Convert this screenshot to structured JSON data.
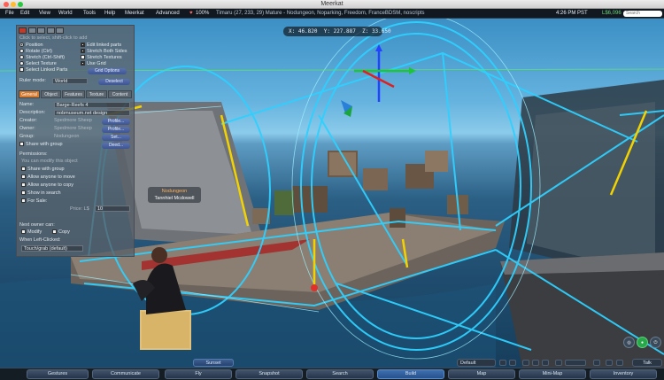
{
  "window": {
    "title": "Meerkat"
  },
  "menu": {
    "items": [
      "File",
      "Edit",
      "View",
      "World",
      "Tools",
      "Help",
      "Meerkat",
      "Advanced"
    ],
    "health": "100%",
    "location": "Timaru (27, 233, 29) Mature - Nodungeon, Noparking, Freedom, FranceBDSM, noscripts",
    "clock": "4:26 PM PST",
    "balance": "L$6,096",
    "search_placeholder": "Search"
  },
  "coords": {
    "x": "X: 46.820",
    "y": "Y: 227.887",
    "z": "Z: 33.650"
  },
  "build_panel": {
    "header": "Click to select, shift-click to add",
    "tool_options": [
      {
        "label": "Position",
        "kind": "radio",
        "checked": true
      },
      {
        "label": "Rotate (Ctrl)",
        "kind": "radio",
        "checked": false
      },
      {
        "label": "Stretch (Ctrl-Shift)",
        "kind": "radio",
        "checked": false
      },
      {
        "label": "Select Texture",
        "kind": "radio",
        "checked": false
      },
      {
        "label": "Select Linked Parts",
        "kind": "check",
        "checked": false
      }
    ],
    "right_options": [
      {
        "label": "Edit linked parts",
        "checked": true
      },
      {
        "label": "Stretch Both Sides",
        "checked": true
      },
      {
        "label": "Stretch Textures",
        "checked": false
      },
      {
        "label": "Use Grid",
        "checked": true
      }
    ],
    "grid_options_btn": "Grid Options",
    "ruler_label": "Ruler mode:",
    "ruler_value": "World",
    "deselect_btn": "Deselect",
    "tabs": [
      "General",
      "Object",
      "Features",
      "Texture",
      "Content"
    ],
    "active_tab": "General",
    "name_label": "Name:",
    "name_value": "Barge-Reefs 4",
    "description_label": "Description:",
    "description_value": "nobmuseum.net design",
    "creator_label": "Creator:",
    "creator_value": "Spedmore Sheep",
    "owner_label": "Owner:",
    "owner_value": "Spedmore Sheep",
    "group_label": "Group:",
    "group_value": "Nodungeon",
    "profile_btn": "Profile...",
    "set_btn": "Set...",
    "share_label": "Share with group",
    "deed_btn": "Deed...",
    "permissions_label": "Permissions:",
    "perm_note": "You can modify this object",
    "perm_options": [
      "Share with group",
      "Allow anyone to move",
      "Allow anyone to copy",
      "Show in search",
      "For Sale:"
    ],
    "price_label": "Price: L$",
    "price_value": "10",
    "next_owner_label": "Next owner can:",
    "next_owner_options": [
      "Modify",
      "Copy"
    ],
    "click_label": "When Left-Clicked:",
    "click_value": "Touch/grab (default)"
  },
  "nametag": {
    "line1": "Nodungeon",
    "line2": "Tannhiel Mcdowell"
  },
  "toolbar": {
    "buttons": [
      "Gestures",
      "Communicate",
      "Fly",
      "Snapshot",
      "Search",
      "Build",
      "Map",
      "Mini-Map",
      "Inventory"
    ],
    "active": "Build",
    "environment_btn": "Sunset",
    "preset_value": "Default",
    "talk_btn": "Talk"
  },
  "colors": {
    "accent": "#d67a2e",
    "toolbar_active": "#3e6fb0",
    "selection": "#2fd0ff",
    "highlight": "#f2d200"
  }
}
